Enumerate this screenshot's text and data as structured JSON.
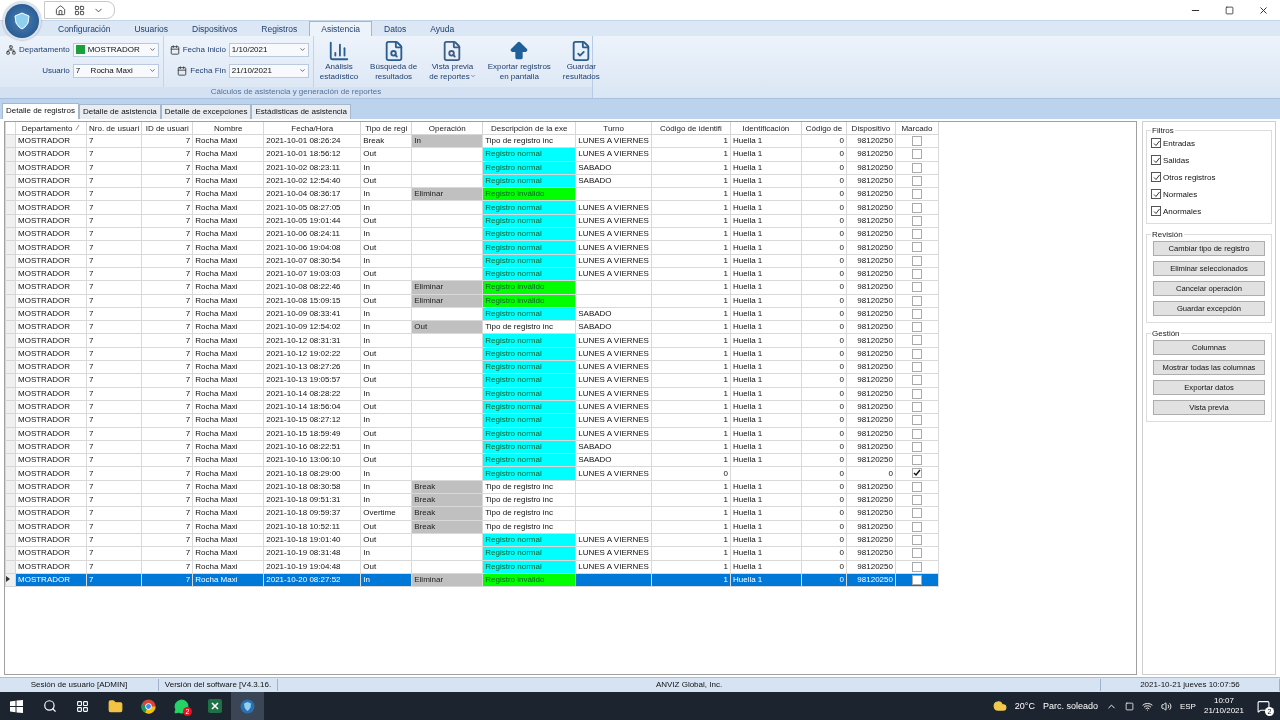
{
  "menu_tabs": [
    {
      "label": "Configuración",
      "selected": false
    },
    {
      "label": "Usuarios",
      "selected": false
    },
    {
      "label": "Dispositivos",
      "selected": false
    },
    {
      "label": "Registros",
      "selected": false
    },
    {
      "label": "Asistencia",
      "selected": true
    },
    {
      "label": "Datos",
      "selected": false
    },
    {
      "label": "Ayuda",
      "selected": false
    }
  ],
  "ribbon": {
    "department": {
      "label": "Departamento",
      "value": "MOSTRADOR"
    },
    "user": {
      "label": "Usuario",
      "id": "7",
      "name": "Rocha Maxi"
    },
    "start_date": {
      "label": "Fecha Inicio",
      "value": "1/10/2021"
    },
    "end_date": {
      "label": "Fecha Fin",
      "value": "21/10/2021"
    },
    "buttons": [
      {
        "kind": "stats",
        "lines": [
          "Análisis",
          "estadístico"
        ],
        "has_menu": false
      },
      {
        "kind": "search",
        "lines": [
          "Búsqueda de",
          "resultados"
        ],
        "has_menu": false
      },
      {
        "kind": "preview",
        "lines": [
          "Vista previa",
          "de reportes"
        ],
        "has_menu": true
      },
      {
        "kind": "export",
        "lines": [
          "Exportar registros",
          "en pantalla"
        ],
        "has_menu": false
      },
      {
        "kind": "save",
        "lines": [
          "Guardar",
          "resultados"
        ],
        "has_menu": false
      }
    ],
    "group_label": "Cálculos de asistencia y generación de reportes"
  },
  "view_tabs": [
    {
      "label": "Detalle de registros",
      "selected": true
    },
    {
      "label": "Detalle de asistencia",
      "selected": false
    },
    {
      "label": "Detalle de excepciones",
      "selected": false
    },
    {
      "label": "Estádisticas de asistencia",
      "selected": false
    }
  ],
  "table": {
    "columns": [
      {
        "label": "Departamento",
        "sorted": true
      },
      {
        "label": "Nro. de usuari",
        "sorted": false
      },
      {
        "label": "ID de usuari",
        "sorted": false
      },
      {
        "label": "Nombre",
        "sorted": false
      },
      {
        "label": "Fecha/Hora",
        "sorted": false
      },
      {
        "label": "Tipo de regi",
        "sorted": false
      },
      {
        "label": "Operación",
        "sorted": false
      },
      {
        "label": "Descripción de la exe",
        "sorted": false
      },
      {
        "label": "Turno",
        "sorted": false
      },
      {
        "label": "Código de identifi",
        "sorted": false
      },
      {
        "label": "Identificación",
        "sorted": false
      },
      {
        "label": "Código de",
        "sorted": false
      },
      {
        "label": "Dispositivo",
        "sorted": false
      },
      {
        "label": "Marcado",
        "sorted": false
      }
    ],
    "rows": [
      {
        "dept": "MOSTRADOR",
        "nro": "7",
        "id": "7",
        "name": "Rocha Maxi",
        "time": "2021-10-01 08:26:24",
        "type": "Break",
        "op": "In",
        "desc": "Tipo de registro inc",
        "kind": "incomplete",
        "shift": "LUNES A VIERNES",
        "code_id": "1",
        "ident": "Huella 1",
        "code": "0",
        "device": "98120250",
        "marked": false,
        "selected": false
      },
      {
        "dept": "MOSTRADOR",
        "nro": "7",
        "id": "7",
        "name": "Rocha Maxi",
        "time": "2021-10-01 18:56:12",
        "type": "Out",
        "desc": "Registro normal",
        "kind": "normal",
        "shift": "LUNES A VIERNES",
        "code_id": "1",
        "ident": "Huella 1",
        "code": "0",
        "device": "98120250",
        "marked": false,
        "selected": false
      },
      {
        "dept": "MOSTRADOR",
        "nro": "7",
        "id": "7",
        "name": "Rocha Maxi",
        "time": "2021-10-02 08:23:11",
        "type": "In",
        "desc": "Registro normal",
        "kind": "normal",
        "shift": "SABADO",
        "code_id": "1",
        "ident": "Huella 1",
        "code": "0",
        "device": "98120250",
        "marked": false,
        "selected": false
      },
      {
        "dept": "MOSTRADOR",
        "nro": "7",
        "id": "7",
        "name": "Rocha Maxi",
        "time": "2021-10-02 12:54:40",
        "type": "Out",
        "desc": "Registro normal",
        "kind": "normal",
        "shift": "SABADO",
        "code_id": "1",
        "ident": "Huella 1",
        "code": "0",
        "device": "98120250",
        "marked": false,
        "selected": false
      },
      {
        "dept": "MOSTRADOR",
        "nro": "7",
        "id": "7",
        "name": "Rocha Maxi",
        "time": "2021-10-04 08:36:17",
        "type": "In",
        "op": "Eliminar",
        "desc": "Registro inválido",
        "kind": "invalid",
        "code_id": "1",
        "ident": "Huella 1",
        "code": "0",
        "device": "98120250",
        "marked": false,
        "selected": false
      },
      {
        "dept": "MOSTRADOR",
        "nro": "7",
        "id": "7",
        "name": "Rocha Maxi",
        "time": "2021-10-05 08:27:05",
        "type": "In",
        "desc": "Registro normal",
        "kind": "normal",
        "shift": "LUNES A VIERNES",
        "code_id": "1",
        "ident": "Huella 1",
        "code": "0",
        "device": "98120250",
        "marked": false,
        "selected": false
      },
      {
        "dept": "MOSTRADOR",
        "nro": "7",
        "id": "7",
        "name": "Rocha Maxi",
        "time": "2021-10-05 19:01:44",
        "type": "Out",
        "desc": "Registro normal",
        "kind": "normal",
        "shift": "LUNES A VIERNES",
        "code_id": "1",
        "ident": "Huella 1",
        "code": "0",
        "device": "98120250",
        "marked": false,
        "selected": false
      },
      {
        "dept": "MOSTRADOR",
        "nro": "7",
        "id": "7",
        "name": "Rocha Maxi",
        "time": "2021-10-06 08:24:11",
        "type": "In",
        "desc": "Registro normal",
        "kind": "normal",
        "shift": "LUNES A VIERNES",
        "code_id": "1",
        "ident": "Huella 1",
        "code": "0",
        "device": "98120250",
        "marked": false,
        "selected": false
      },
      {
        "dept": "MOSTRADOR",
        "nro": "7",
        "id": "7",
        "name": "Rocha Maxi",
        "time": "2021-10-06 19:04:08",
        "type": "Out",
        "desc": "Registro normal",
        "kind": "normal",
        "shift": "LUNES A VIERNES",
        "code_id": "1",
        "ident": "Huella 1",
        "code": "0",
        "device": "98120250",
        "marked": false,
        "selected": false
      },
      {
        "dept": "MOSTRADOR",
        "nro": "7",
        "id": "7",
        "name": "Rocha Maxi",
        "time": "2021-10-07 08:30:54",
        "type": "In",
        "desc": "Registro normal",
        "kind": "normal",
        "shift": "LUNES A VIERNES",
        "code_id": "1",
        "ident": "Huella 1",
        "code": "0",
        "device": "98120250",
        "marked": false,
        "selected": false
      },
      {
        "dept": "MOSTRADOR",
        "nro": "7",
        "id": "7",
        "name": "Rocha Maxi",
        "time": "2021-10-07 19:03:03",
        "type": "Out",
        "desc": "Registro normal",
        "kind": "normal",
        "shift": "LUNES A VIERNES",
        "code_id": "1",
        "ident": "Huella 1",
        "code": "0",
        "device": "98120250",
        "marked": false,
        "selected": false
      },
      {
        "dept": "MOSTRADOR",
        "nro": "7",
        "id": "7",
        "name": "Rocha Maxi",
        "time": "2021-10-08 08:22:46",
        "type": "In",
        "op": "Eliminar",
        "desc": "Registro inválido",
        "kind": "invalid",
        "code_id": "1",
        "ident": "Huella 1",
        "code": "0",
        "device": "98120250",
        "marked": false,
        "selected": false
      },
      {
        "dept": "MOSTRADOR",
        "nro": "7",
        "id": "7",
        "name": "Rocha Maxi",
        "time": "2021-10-08 15:09:15",
        "type": "Out",
        "op": "Eliminar",
        "desc": "Registro inválido",
        "kind": "invalid",
        "code_id": "1",
        "ident": "Huella 1",
        "code": "0",
        "device": "98120250",
        "marked": false,
        "selected": false
      },
      {
        "dept": "MOSTRADOR",
        "nro": "7",
        "id": "7",
        "name": "Rocha Maxi",
        "time": "2021-10-09 08:33:41",
        "type": "In",
        "desc": "Registro normal",
        "kind": "normal",
        "shift": "SABADO",
        "code_id": "1",
        "ident": "Huella 1",
        "code": "0",
        "device": "98120250",
        "marked": false,
        "selected": false
      },
      {
        "dept": "MOSTRADOR",
        "nro": "7",
        "id": "7",
        "name": "Rocha Maxi",
        "time": "2021-10-09 12:54:02",
        "type": "In",
        "op": "Out",
        "desc": "Tipo de registro inc",
        "kind": "incomplete",
        "shift": "SABADO",
        "code_id": "1",
        "ident": "Huella 1",
        "code": "0",
        "device": "98120250",
        "marked": false,
        "selected": false
      },
      {
        "dept": "MOSTRADOR",
        "nro": "7",
        "id": "7",
        "name": "Rocha Maxi",
        "time": "2021-10-12 08:31:31",
        "type": "In",
        "desc": "Registro normal",
        "kind": "normal",
        "shift": "LUNES A VIERNES",
        "code_id": "1",
        "ident": "Huella 1",
        "code": "0",
        "device": "98120250",
        "marked": false,
        "selected": false
      },
      {
        "dept": "MOSTRADOR",
        "nro": "7",
        "id": "7",
        "name": "Rocha Maxi",
        "time": "2021-10-12 19:02:22",
        "type": "Out",
        "desc": "Registro normal",
        "kind": "normal",
        "shift": "LUNES A VIERNES",
        "code_id": "1",
        "ident": "Huella 1",
        "code": "0",
        "device": "98120250",
        "marked": false,
        "selected": false
      },
      {
        "dept": "MOSTRADOR",
        "nro": "7",
        "id": "7",
        "name": "Rocha Maxi",
        "time": "2021-10-13 08:27:26",
        "type": "In",
        "desc": "Registro normal",
        "kind": "normal",
        "shift": "LUNES A VIERNES",
        "code_id": "1",
        "ident": "Huella 1",
        "code": "0",
        "device": "98120250",
        "marked": false,
        "selected": false
      },
      {
        "dept": "MOSTRADOR",
        "nro": "7",
        "id": "7",
        "name": "Rocha Maxi",
        "time": "2021-10-13 19:05:57",
        "type": "Out",
        "desc": "Registro normal",
        "kind": "normal",
        "shift": "LUNES A VIERNES",
        "code_id": "1",
        "ident": "Huella 1",
        "code": "0",
        "device": "98120250",
        "marked": false,
        "selected": false
      },
      {
        "dept": "MOSTRADOR",
        "nro": "7",
        "id": "7",
        "name": "Rocha Maxi",
        "time": "2021-10-14 08:28:22",
        "type": "In",
        "desc": "Registro normal",
        "kind": "normal",
        "shift": "LUNES A VIERNES",
        "code_id": "1",
        "ident": "Huella 1",
        "code": "0",
        "device": "98120250",
        "marked": false,
        "selected": false
      },
      {
        "dept": "MOSTRADOR",
        "nro": "7",
        "id": "7",
        "name": "Rocha Maxi",
        "time": "2021-10-14 18:56:04",
        "type": "Out",
        "desc": "Registro normal",
        "kind": "normal",
        "shift": "LUNES A VIERNES",
        "code_id": "1",
        "ident": "Huella 1",
        "code": "0",
        "device": "98120250",
        "marked": false,
        "selected": false
      },
      {
        "dept": "MOSTRADOR",
        "nro": "7",
        "id": "7",
        "name": "Rocha Maxi",
        "time": "2021-10-15 08:27:12",
        "type": "In",
        "desc": "Registro normal",
        "kind": "normal",
        "shift": "LUNES A VIERNES",
        "code_id": "1",
        "ident": "Huella 1",
        "code": "0",
        "device": "98120250",
        "marked": false,
        "selected": false
      },
      {
        "dept": "MOSTRADOR",
        "nro": "7",
        "id": "7",
        "name": "Rocha Maxi",
        "time": "2021-10-15 18:59:49",
        "type": "Out",
        "desc": "Registro normal",
        "kind": "normal",
        "shift": "LUNES A VIERNES",
        "code_id": "1",
        "ident": "Huella 1",
        "code": "0",
        "device": "98120250",
        "marked": false,
        "selected": false
      },
      {
        "dept": "MOSTRADOR",
        "nro": "7",
        "id": "7",
        "name": "Rocha Maxi",
        "time": "2021-10-16 08:22:51",
        "type": "In",
        "desc": "Registro normal",
        "kind": "normal",
        "shift": "SABADO",
        "code_id": "1",
        "ident": "Huella 1",
        "code": "0",
        "device": "98120250",
        "marked": false,
        "selected": false
      },
      {
        "dept": "MOSTRADOR",
        "nro": "7",
        "id": "7",
        "name": "Rocha Maxi",
        "time": "2021-10-16 13:06:10",
        "type": "Out",
        "desc": "Registro normal",
        "kind": "normal",
        "shift": "SABADO",
        "code_id": "1",
        "ident": "Huella 1",
        "code": "0",
        "device": "98120250",
        "marked": false,
        "selected": false
      },
      {
        "dept": "MOSTRADOR",
        "nro": "7",
        "id": "7",
        "name": "Rocha Maxi",
        "time": "2021-10-18 08:29:00",
        "type": "In",
        "desc": "Registro normal",
        "kind": "normal",
        "shift": "LUNES A VIERNES",
        "code_id": "0",
        "code": "0",
        "device": "0",
        "marked": true,
        "selected": false
      },
      {
        "dept": "MOSTRADOR",
        "nro": "7",
        "id": "7",
        "name": "Rocha Maxi",
        "time": "2021-10-18 08:30:58",
        "type": "In",
        "op": "Break",
        "desc": "Tipo de registro inc",
        "kind": "incomplete",
        "code_id": "1",
        "ident": "Huella 1",
        "code": "0",
        "device": "98120250",
        "marked": false,
        "selected": false
      },
      {
        "dept": "MOSTRADOR",
        "nro": "7",
        "id": "7",
        "name": "Rocha Maxi",
        "time": "2021-10-18 09:51:31",
        "type": "In",
        "op": "Break",
        "desc": "Tipo de registro inc",
        "kind": "incomplete",
        "code_id": "1",
        "ident": "Huella 1",
        "code": "0",
        "device": "98120250",
        "marked": false,
        "selected": false
      },
      {
        "dept": "MOSTRADOR",
        "nro": "7",
        "id": "7",
        "name": "Rocha Maxi",
        "time": "2021-10-18 09:59:37",
        "type": "Overtime",
        "op": "Break",
        "desc": "Tipo de registro inc",
        "kind": "incomplete",
        "code_id": "1",
        "ident": "Huella 1",
        "code": "0",
        "device": "98120250",
        "marked": false,
        "selected": false
      },
      {
        "dept": "MOSTRADOR",
        "nro": "7",
        "id": "7",
        "name": "Rocha Maxi",
        "time": "2021-10-18 10:52:11",
        "type": "Out",
        "op": "Break",
        "desc": "Tipo de registro inc",
        "kind": "incomplete",
        "code_id": "1",
        "ident": "Huella 1",
        "code": "0",
        "device": "98120250",
        "marked": false,
        "selected": false
      },
      {
        "dept": "MOSTRADOR",
        "nro": "7",
        "id": "7",
        "name": "Rocha Maxi",
        "time": "2021-10-18 19:01:40",
        "type": "Out",
        "desc": "Registro normal",
        "kind": "normal",
        "shift": "LUNES A VIERNES",
        "code_id": "1",
        "ident": "Huella 1",
        "code": "0",
        "device": "98120250",
        "marked": false,
        "selected": false
      },
      {
        "dept": "MOSTRADOR",
        "nro": "7",
        "id": "7",
        "name": "Rocha Maxi",
        "time": "2021-10-19 08:31:48",
        "type": "In",
        "desc": "Registro normal",
        "kind": "normal",
        "shift": "LUNES A VIERNES",
        "code_id": "1",
        "ident": "Huella 1",
        "code": "0",
        "device": "98120250",
        "marked": false,
        "selected": false
      },
      {
        "dept": "MOSTRADOR",
        "nro": "7",
        "id": "7",
        "name": "Rocha Maxi",
        "time": "2021-10-19 19:04:48",
        "type": "Out",
        "desc": "Registro normal",
        "kind": "normal",
        "shift": "LUNES A VIERNES",
        "code_id": "1",
        "ident": "Huella 1",
        "code": "0",
        "device": "98120250",
        "marked": false,
        "selected": false
      },
      {
        "dept": "MOSTRADOR",
        "nro": "7",
        "id": "7",
        "name": "Rocha Maxi",
        "time": "2021-10-20 08:27:52",
        "type": "In",
        "op": "Eliminar",
        "desc": "Registro inválido",
        "kind": "invalid",
        "code_id": "1",
        "ident": "Huella 1",
        "code": "0",
        "device": "98120250",
        "marked": false,
        "selected": true
      }
    ]
  },
  "filters": {
    "title": "Filtros",
    "items": [
      {
        "label": "Entradas",
        "checked": true
      },
      {
        "label": "Salidas",
        "checked": true
      },
      {
        "label": "Otros registros",
        "checked": true
      },
      {
        "label": "Normales",
        "checked": true
      },
      {
        "label": "Anormales",
        "checked": true
      }
    ]
  },
  "review": {
    "title": "Revisión",
    "buttons": [
      "Cambiar tipo de registro",
      "Eliminar seleccionados",
      "Cancelar operación",
      "Guardar excepción"
    ]
  },
  "management": {
    "title": "Gestión",
    "buttons": [
      "Columnas",
      "Mostrar todas las columnas",
      "Exportar datos",
      "Vista previa"
    ]
  },
  "status_bar": {
    "session": "Sesión de usuario  [ADMIN]",
    "version": "Versión del software  [V4.3.16.",
    "company": "ANVIZ Global, Inc.",
    "datetime": "2021-10-21 jueves 10:07:56"
  },
  "taskbar": {
    "chat_badge": "2",
    "temperature": "20°C",
    "weather": "Parc. soleado",
    "language": "ESP",
    "time": "10:07",
    "date": "21/10/2021",
    "notifications": "2"
  }
}
